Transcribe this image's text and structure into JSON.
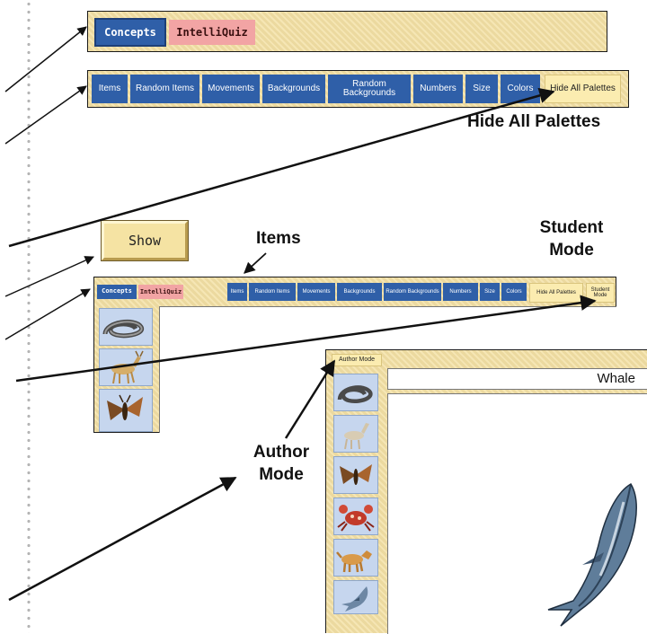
{
  "top_bar": {
    "concepts_label": "Concepts",
    "intelliquiz_label": "IntelliQuiz"
  },
  "palette_bar": {
    "items": [
      "Items",
      "Random Items",
      "Movements",
      "Backgrounds",
      "Random Backgrounds",
      "Numbers",
      "Size",
      "Colors"
    ],
    "hide_all_label": "Hide All Palettes"
  },
  "show_button": {
    "label": "Show"
  },
  "small_window": {
    "concepts_label": "Concepts",
    "intelliquiz_label": "IntelliQuiz",
    "items": [
      "Items",
      "Random Items",
      "Movements",
      "Backgrounds",
      "Random Backgrounds",
      "Numbers",
      "Size",
      "Colors"
    ],
    "hide_all_label": "Hide All Palettes",
    "student_mode_label": "Student Mode",
    "icons": [
      "snake-icon",
      "deer-icon",
      "moth-icon"
    ]
  },
  "author_window": {
    "author_mode_label": "Author Mode",
    "item_title": "Whale",
    "icons": [
      "snake-icon",
      "deer-icon",
      "moth-icon",
      "crab-icon",
      "dog-icon",
      "dolphin-icon"
    ]
  },
  "callouts": {
    "hide_all_palettes": "Hide All Palettes",
    "items": "Items",
    "student_mode": "Student Mode",
    "author_mode": "Author Mode"
  },
  "colors": {
    "blue": "#2f5fa8",
    "pink": "#f2a4a4",
    "cream": "#f3e0a4",
    "palette_blue": "#c6d6ee"
  }
}
